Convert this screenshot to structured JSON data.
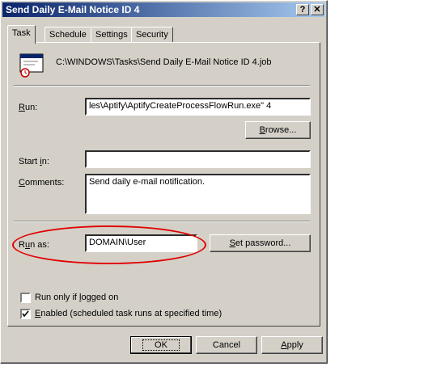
{
  "window": {
    "title": "Send Daily E-Mail Notice ID 4",
    "help_btn": "?",
    "close_btn": "✕"
  },
  "tabs": [
    {
      "label": "Task",
      "active": true
    },
    {
      "label": "Schedule",
      "active": false
    },
    {
      "label": "Settings",
      "active": false
    },
    {
      "label": "Security",
      "active": false
    }
  ],
  "task": {
    "icon": "scheduled-task-icon",
    "path": "C:\\WINDOWS\\Tasks\\Send Daily E-Mail Notice ID 4.job",
    "run_label_u": "R",
    "run_label_rest": "un:",
    "run_value": "les\\Aptify\\AptifyCreateProcessFlowRun.exe\" 4",
    "browse_label_u": "B",
    "browse_label_rest": "rowse...",
    "start_in_label_pre": "Start ",
    "start_in_label_u": "i",
    "start_in_label_rest": "n:",
    "start_in_value": "",
    "comments_label_u": "C",
    "comments_label_rest": "omments:",
    "comments_value": "Send daily e-mail notification.",
    "run_as_label_pre": "R",
    "run_as_label_u": "u",
    "run_as_label_rest": "n as:",
    "run_as_value": "DOMAIN\\User",
    "set_password_label_u": "S",
    "set_password_label_rest": "et password...",
    "run_only_logged_pre": "Run only if ",
    "run_only_logged_u": "l",
    "run_only_logged_rest": "ogged on",
    "run_only_logged_checked": false,
    "enabled_u": "E",
    "enabled_rest": "nabled (scheduled task runs at specified time)",
    "enabled_checked": true,
    "highlight_color": "#e00000"
  },
  "buttons": {
    "ok": "OK",
    "cancel": "Cancel",
    "apply_u": "A",
    "apply_rest": "pply"
  }
}
